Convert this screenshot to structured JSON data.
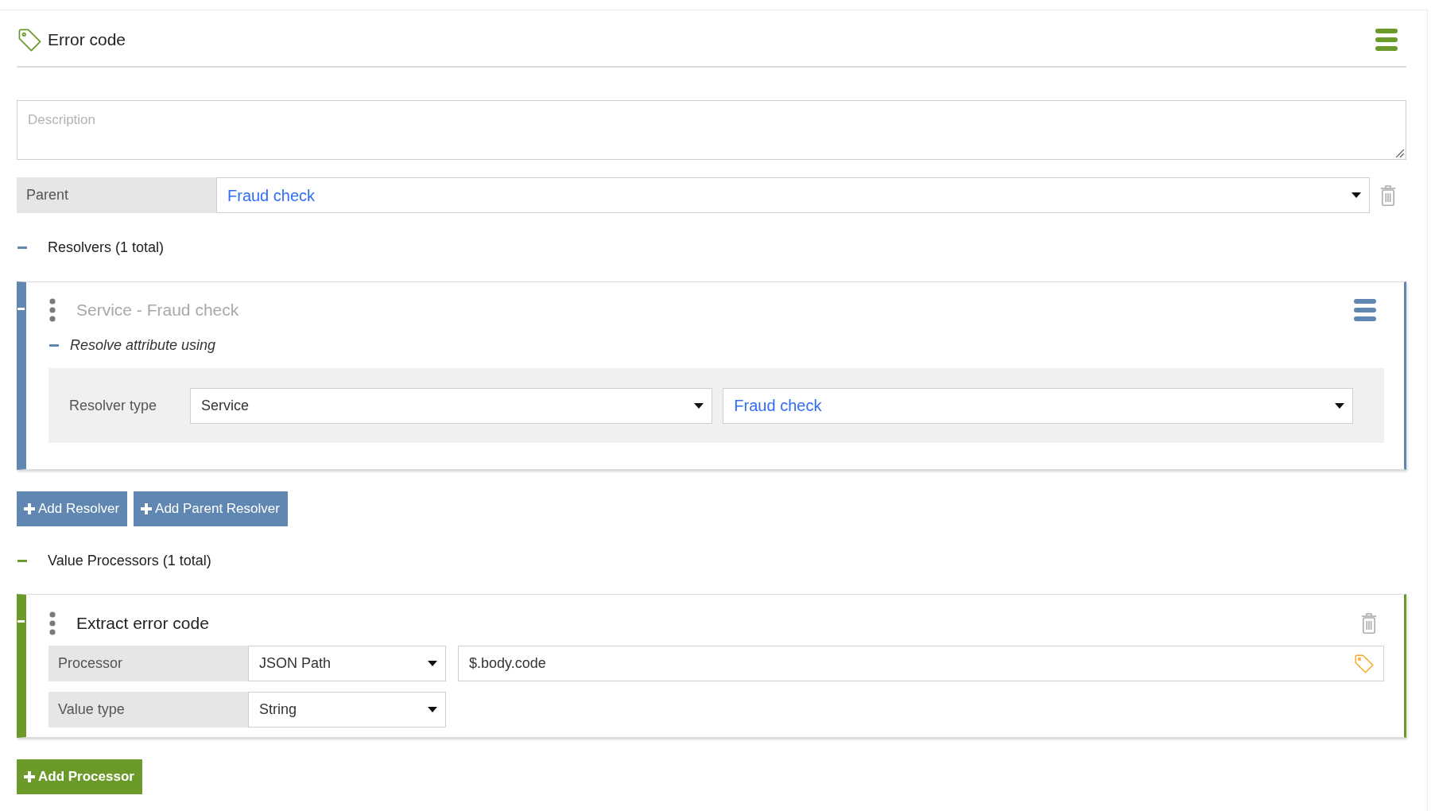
{
  "header": {
    "title": "Error code"
  },
  "description": {
    "placeholder": "Description"
  },
  "parent": {
    "label": "Parent",
    "value": "Fraud check"
  },
  "resolvers": {
    "heading": "Resolvers (1 total)",
    "expanded": true,
    "items": [
      {
        "title": "Service - Fraud check",
        "section": {
          "heading": "Resolve attribute using",
          "expanded": true
        },
        "resolver_type": {
          "label": "Resolver type",
          "value": "Service",
          "target": "Fraud check"
        }
      }
    ],
    "buttons": [
      {
        "label": "Add Resolver"
      },
      {
        "label": "Add Parent Resolver"
      }
    ]
  },
  "value_processors": {
    "heading": "Value Processors (1 total)",
    "expanded": true,
    "items": [
      {
        "title": "Extract error code",
        "fields": [
          {
            "kind": "select_with_input",
            "label": "Processor",
            "value": "JSON Path",
            "input_value": "$.body.code"
          },
          {
            "kind": "select",
            "label": "Value type",
            "value": "String"
          }
        ]
      }
    ],
    "buttons": [
      {
        "label": "Add Processor"
      }
    ]
  }
}
